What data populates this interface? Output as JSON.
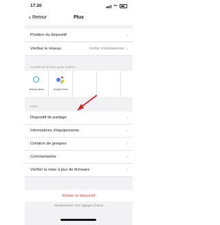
{
  "status_bar": {
    "time": "17:20"
  },
  "nav": {
    "back_label": "Retour",
    "title": "Plus"
  },
  "rows_top": [
    {
      "label": "Position du dispositif",
      "value": ""
    },
    {
      "label": "Vérifiez le réseau",
      "value": "Vérifier immédiatement"
    }
  ],
  "third_party_section": {
    "label": "Contrôle de la tierce partie soutenu",
    "tiles": [
      {
        "label": "amazon alexa",
        "icon": "alexa-icon"
      },
      {
        "label": "Google Home",
        "icon": "google-assistant-icon"
      }
    ]
  },
  "divers_section": {
    "label": "Divers",
    "rows": [
      {
        "label": "Dispositif de partage"
      },
      {
        "label": "Informations d'équipements"
      },
      {
        "label": "Création de groupes"
      },
      {
        "label": "Commentaires"
      },
      {
        "label": "Vérifier la mise à jour de firmware"
      }
    ]
  },
  "danger_action": {
    "label": "Retirer le dispositif",
    "color": "#e0463b"
  },
  "footer": {
    "label": "Réinitialisation des réglages d'usine"
  },
  "colors": {
    "annotation_arrow": "#e02020",
    "alexa": "#1aa3d9"
  }
}
